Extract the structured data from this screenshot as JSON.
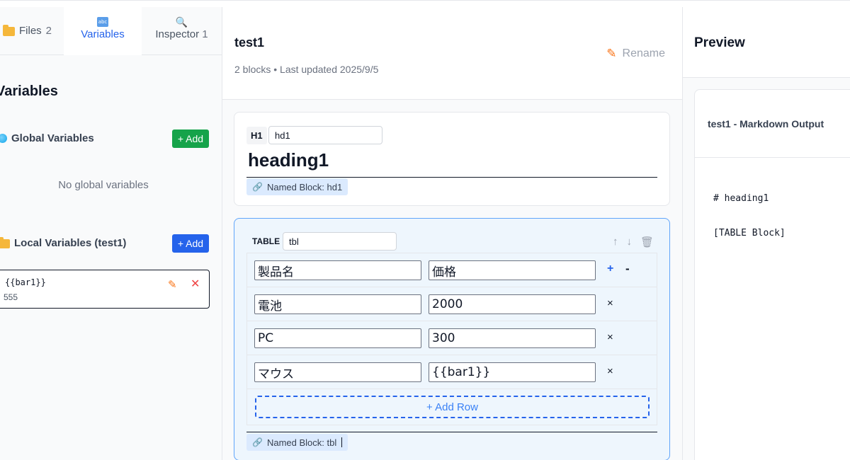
{
  "sidebar": {
    "tabs": {
      "files": {
        "label": "Files",
        "count": "2"
      },
      "variables": {
        "label": "Variables",
        "icon": "abc-icon"
      },
      "inspector": {
        "label": "Inspector",
        "count": "1",
        "icon": "search-icon"
      }
    },
    "title": "Variables",
    "global": {
      "title": "Global Variables",
      "add_label": "+ Add",
      "empty_text": "No global variables"
    },
    "local": {
      "title": "Local Variables (test1)",
      "add_label": "+ Add",
      "items": [
        {
          "name": "{{bar1}}",
          "value": "555"
        }
      ]
    }
  },
  "editor": {
    "title": "test1",
    "meta": "2 blocks • Last updated 2025/9/5",
    "rename_label": "Rename",
    "blocks": [
      {
        "type": "H1",
        "name": "hd1",
        "text": "heading1",
        "named_label": "Named Block: hd1"
      },
      {
        "type": "TABLE",
        "name": "tbl",
        "header": [
          "製品名",
          "価格"
        ],
        "rows": [
          [
            "電池",
            "2000"
          ],
          [
            "PC",
            "300"
          ],
          [
            "マウス",
            "{{bar1}}"
          ]
        ],
        "add_col": "+",
        "remove_col": "-",
        "remove_row": "×",
        "add_row_label": "+ Add Row",
        "actions": {
          "up": "↑",
          "down": "↓"
        },
        "named_label": "Named Block: tbl"
      }
    ]
  },
  "preview": {
    "title": "Preview",
    "output_title": "test1 - Markdown Output",
    "lines": [
      "# heading1",
      "[TABLE Block]"
    ]
  },
  "colors": {
    "accent": "#2563eb",
    "green": "#16a34a",
    "selected_block_bg": "#eef6fd"
  }
}
